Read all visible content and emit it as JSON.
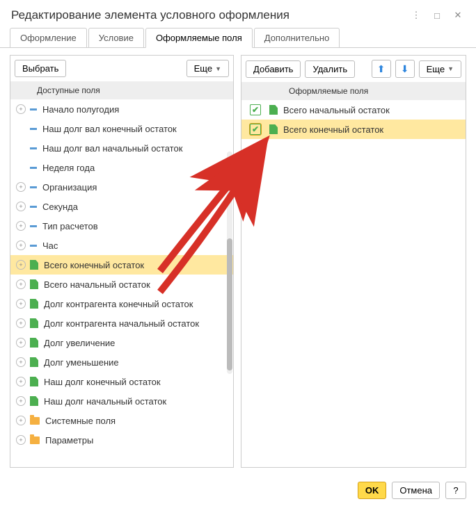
{
  "window": {
    "title": "Редактирование элемента условного оформления"
  },
  "tabs": [
    {
      "label": "Оформление"
    },
    {
      "label": "Условие"
    },
    {
      "label": "Оформляемые поля"
    },
    {
      "label": "Дополнительно"
    }
  ],
  "toolbar_left": {
    "select": "Выбрать",
    "more": "Еще"
  },
  "toolbar_right": {
    "add": "Добавить",
    "delete": "Удалить",
    "more": "Еще"
  },
  "header_left": "Доступные поля",
  "header_right": "Оформляемые поля",
  "tree": [
    {
      "label": "Начало полугодия",
      "expander": "plus",
      "icon": "dash"
    },
    {
      "label": "Наш долг вал конечный остаток",
      "expander": "none",
      "icon": "dash"
    },
    {
      "label": "Наш долг вал начальный остаток",
      "expander": "none",
      "icon": "dash"
    },
    {
      "label": "Неделя года",
      "expander": "none",
      "icon": "dash"
    },
    {
      "label": "Организация",
      "expander": "plus",
      "icon": "dash"
    },
    {
      "label": "Секунда",
      "expander": "plus",
      "icon": "dash"
    },
    {
      "label": "Тип расчетов",
      "expander": "plus",
      "icon": "dash"
    },
    {
      "label": "Час",
      "expander": "plus",
      "icon": "dash"
    },
    {
      "label": "Всего конечный остаток",
      "expander": "plus",
      "icon": "green",
      "hl": true
    },
    {
      "label": "Всего начальный остаток",
      "expander": "plus",
      "icon": "green"
    },
    {
      "label": "Долг контрагента конечный остаток",
      "expander": "plus",
      "icon": "green"
    },
    {
      "label": "Долг контрагента начальный остаток",
      "expander": "plus",
      "icon": "green"
    },
    {
      "label": "Долг увеличение",
      "expander": "plus",
      "icon": "green"
    },
    {
      "label": "Долг уменьшение",
      "expander": "plus",
      "icon": "green"
    },
    {
      "label": "Наш долг конечный остаток",
      "expander": "plus",
      "icon": "green"
    },
    {
      "label": "Наш долг начальный остаток",
      "expander": "plus",
      "icon": "green"
    },
    {
      "label": "Системные поля",
      "expander": "plus",
      "icon": "folder"
    },
    {
      "label": "Параметры",
      "expander": "plus",
      "icon": "folder"
    }
  ],
  "right_items": [
    {
      "label": "Всего начальный остаток"
    },
    {
      "label": "Всего конечный остаток",
      "hl": true
    }
  ],
  "footer": {
    "ok": "OK",
    "cancel": "Отмена",
    "help": "?"
  }
}
